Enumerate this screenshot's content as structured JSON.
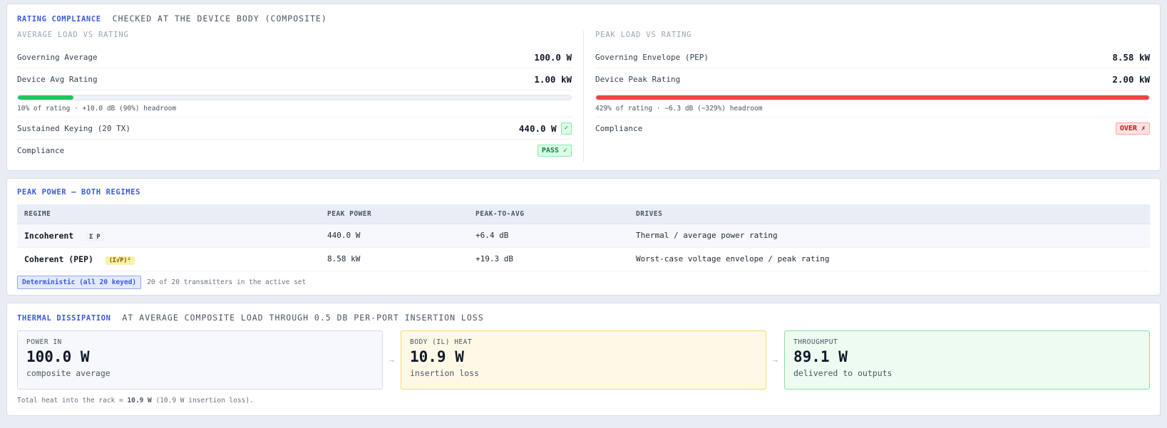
{
  "rating": {
    "title": "RATING COMPLIANCE",
    "subtitle": "CHECKED AT THE DEVICE BODY (COMPOSITE)",
    "average": {
      "title": "AVERAGE LOAD VS RATING",
      "governing_label": "Governing Average",
      "governing_value": "100.0 W",
      "rating_label": "Device Avg Rating",
      "rating_value": "1.00 kW",
      "bar_fraction": 0.1,
      "bar_color": "#22c55e",
      "bar_caption": "10% of rating · +10.0 dB (90%) headroom",
      "sustained_label": "Sustained Keying (20 TX)",
      "sustained_value": "440.0 W",
      "sustained_badge": "✓",
      "compliance_label": "Compliance",
      "compliance_badge": "PASS ✓"
    },
    "peak": {
      "title": "PEAK LOAD VS RATING",
      "governing_label": "Governing Envelope (PEP)",
      "governing_value": "8.58 kW",
      "rating_label": "Device Peak Rating",
      "rating_value": "2.00 kW",
      "bar_fraction": 1.0,
      "bar_color": "#ef4444",
      "bar_caption": "429% of rating · −6.3 dB (−329%) headroom",
      "compliance_label": "Compliance",
      "compliance_badge": "OVER ✗"
    }
  },
  "peak_power": {
    "title": "PEAK POWER — BOTH REGIMES",
    "columns": [
      "REGIME",
      "PEAK POWER",
      "PEAK-TO-AVG",
      "DRIVES"
    ],
    "rows": [
      {
        "regime": "Incoherent",
        "tag": "Σ P",
        "peak": "440.0 W",
        "ratio": "+6.4 dB",
        "drives": "Thermal / average power rating"
      },
      {
        "regime": "Coherent (PEP)",
        "tag": "(Σ√P)²",
        "peak": "8.58 kW",
        "ratio": "+19.3 dB",
        "drives": "Worst-case voltage envelope / peak rating"
      }
    ],
    "mode_button": "Deterministic (all 20 keyed)",
    "mode_note": "20 of 20 transmitters in the active set"
  },
  "thermal": {
    "title": "THERMAL DISSIPATION",
    "subtitle": "AT AVERAGE COMPOSITE LOAD THROUGH 0.5 DB PER-PORT INSERTION LOSS",
    "power_in": {
      "label": "POWER IN",
      "value": "100.0 W",
      "desc": "composite average"
    },
    "body_heat": {
      "label": "BODY (IL) HEAT",
      "value": "10.9 W",
      "desc": "insertion loss"
    },
    "throughput": {
      "label": "THROUGHPUT",
      "value": "89.1 W",
      "desc": "delivered to outputs"
    },
    "arrow": "→",
    "total_prefix": "Total heat into the rack = ",
    "total_value": "10.9 W",
    "total_suffix": " (10.9 W insertion loss)."
  }
}
